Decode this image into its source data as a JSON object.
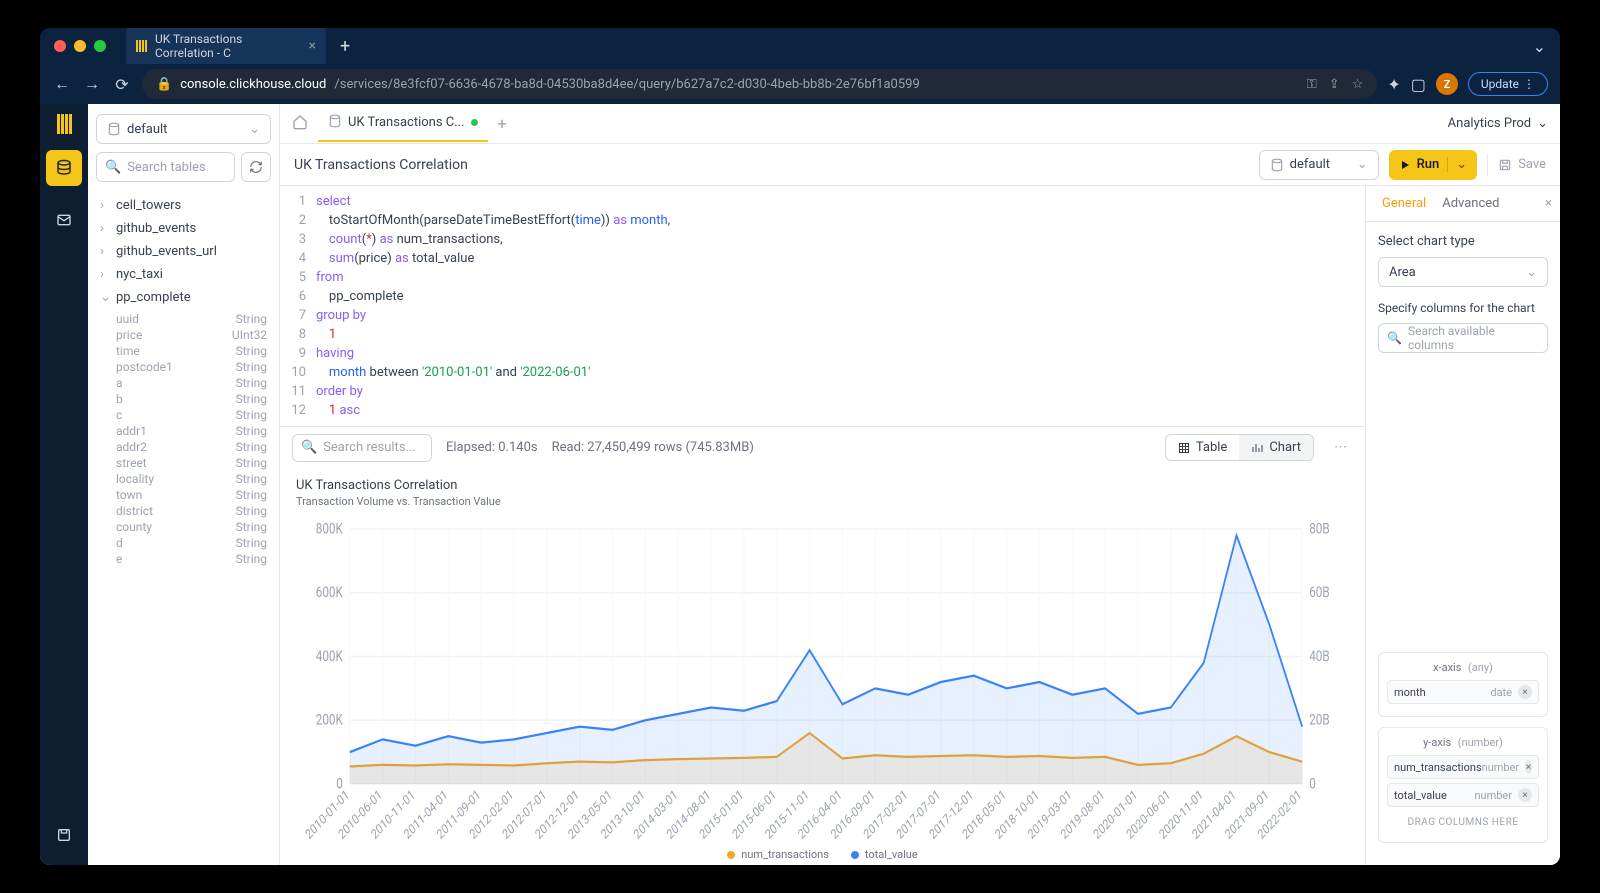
{
  "browser": {
    "tab_title": "UK Transactions Correlation - C",
    "url_host": "console.clickhouse.cloud",
    "url_path": "/services/8e3fcf07-6636-4678-ba8d-04530ba8d4ee/query/b627a7c2-d030-4beb-bb8b-2e76bf1a0599",
    "avatar_letter": "Z",
    "update_label": "Update"
  },
  "sidebar": {
    "database_label": "default",
    "search_placeholder": "Search tables",
    "tables": [
      {
        "name": "cell_towers",
        "expanded": false
      },
      {
        "name": "github_events",
        "expanded": false
      },
      {
        "name": "github_events_url",
        "expanded": false
      },
      {
        "name": "nyc_taxi",
        "expanded": false
      },
      {
        "name": "pp_complete",
        "expanded": true
      }
    ],
    "columns": [
      {
        "name": "uuid",
        "type": "String"
      },
      {
        "name": "price",
        "type": "UInt32"
      },
      {
        "name": "time",
        "type": "String"
      },
      {
        "name": "postcode1",
        "type": "String"
      },
      {
        "name": "a",
        "type": "String"
      },
      {
        "name": "b",
        "type": "String"
      },
      {
        "name": "c",
        "type": "String"
      },
      {
        "name": "addr1",
        "type": "String"
      },
      {
        "name": "addr2",
        "type": "String"
      },
      {
        "name": "street",
        "type": "String"
      },
      {
        "name": "locality",
        "type": "String"
      },
      {
        "name": "town",
        "type": "String"
      },
      {
        "name": "district",
        "type": "String"
      },
      {
        "name": "county",
        "type": "String"
      },
      {
        "name": "d",
        "type": "String"
      },
      {
        "name": "e",
        "type": "String"
      }
    ]
  },
  "topbar": {
    "tab_label": "UK Transactions C...",
    "project_label": "Analytics Prod"
  },
  "query": {
    "title": "UK Transactions Correlation",
    "db_selector": "default",
    "run_label": "Run",
    "save_label": "Save",
    "lines": 12
  },
  "status": {
    "search_placeholder": "Search results...",
    "elapsed_label": "Elapsed: 0.140s",
    "read_label": "Read: 27,450,499 rows (745.83MB)",
    "table_label": "Table",
    "chart_label": "Chart"
  },
  "config": {
    "tab_general": "General",
    "tab_advanced": "Advanced",
    "select_chart_type_label": "Select chart type",
    "chart_type_value": "Area",
    "specify_columns_label": "Specify columns for the chart",
    "search_columns_placeholder": "Search available columns",
    "xaxis_label": "x-axis",
    "xaxis_type": "(any)",
    "xaxis_items": [
      {
        "name": "month",
        "type": "date"
      }
    ],
    "yaxis_label": "y-axis",
    "yaxis_type": "(number)",
    "yaxis_items": [
      {
        "name": "num_transactions",
        "type": "number"
      },
      {
        "name": "total_value",
        "type": "number"
      }
    ],
    "drop_hint": "DRAG COLUMNS HERE"
  },
  "chart": {
    "title": "UK Transactions Correlation",
    "subtitle": "Transaction Volume vs. Transaction Value",
    "legend": [
      {
        "name": "num_transactions",
        "color": "#f5a623"
      },
      {
        "name": "total_value",
        "color": "#3b82f6"
      }
    ]
  },
  "chart_data": {
    "type": "area",
    "title": "UK Transactions Correlation",
    "subtitle": "Transaction Volume vs. Transaction Value",
    "xlabel": "month",
    "y_left_label": "num_transactions",
    "y_right_label": "total_value",
    "y_left_ticks": [
      0,
      200000,
      400000,
      600000,
      800000
    ],
    "y_left_tick_labels": [
      "0",
      "200K",
      "400K",
      "600K",
      "800K"
    ],
    "y_right_ticks": [
      0,
      20000000000,
      40000000000,
      60000000000,
      80000000000
    ],
    "y_right_tick_labels": [
      "0",
      "20B",
      "40B",
      "60B",
      "80B"
    ],
    "x": [
      "2010-01-01",
      "2010-06-01",
      "2010-11-01",
      "2011-04-01",
      "2011-09-01",
      "2012-02-01",
      "2012-07-01",
      "2012-12-01",
      "2013-05-01",
      "2013-10-01",
      "2014-03-01",
      "2014-08-01",
      "2015-01-01",
      "2015-06-01",
      "2015-11-01",
      "2016-04-01",
      "2016-09-01",
      "2017-02-01",
      "2017-07-01",
      "2017-12-01",
      "2018-05-01",
      "2018-10-01",
      "2019-03-01",
      "2019-08-01",
      "2020-01-01",
      "2020-06-01",
      "2020-11-01",
      "2021-04-01",
      "2021-09-01",
      "2022-02-01"
    ],
    "series": [
      {
        "name": "num_transactions",
        "axis": "left",
        "color": "#f5a623",
        "values": [
          55000,
          60000,
          58000,
          62000,
          60000,
          58000,
          65000,
          70000,
          68000,
          75000,
          78000,
          80000,
          82000,
          85000,
          160000,
          80000,
          90000,
          85000,
          88000,
          90000,
          85000,
          88000,
          82000,
          85000,
          60000,
          65000,
          95000,
          150000,
          100000,
          70000
        ]
      },
      {
        "name": "total_value",
        "axis": "right",
        "color": "#3b82f6",
        "values": [
          10000000000,
          14000000000,
          12000000000,
          15000000000,
          13000000000,
          14000000000,
          16000000000,
          18000000000,
          17000000000,
          20000000000,
          22000000000,
          24000000000,
          23000000000,
          26000000000,
          42000000000,
          25000000000,
          30000000000,
          28000000000,
          32000000000,
          34000000000,
          30000000000,
          32000000000,
          28000000000,
          30000000000,
          22000000000,
          24000000000,
          38000000000,
          78000000000,
          50000000000,
          18000000000
        ]
      }
    ]
  }
}
